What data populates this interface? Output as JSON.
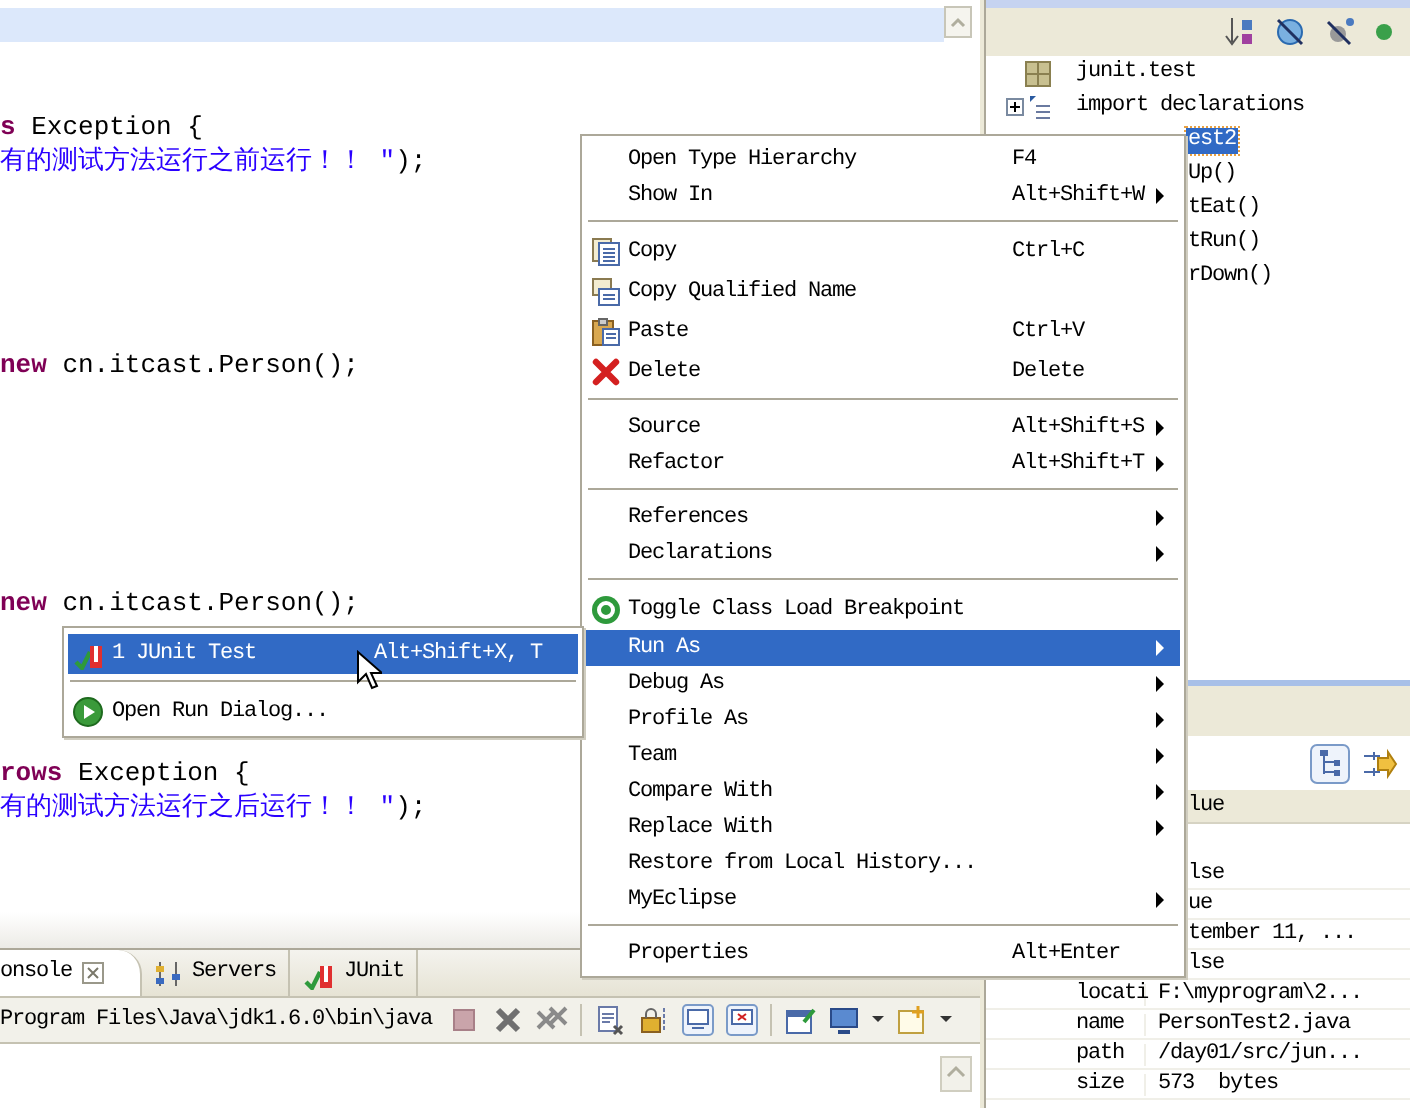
{
  "editor": {
    "lines": [
      {
        "kind": "blank",
        "current": true
      },
      {
        "kind": "blank",
        "current": false
      },
      {
        "kind": "blank",
        "current": false
      },
      {
        "kind": "code",
        "current": false,
        "segments": [
          {
            "kind": "keyword",
            "text": "s"
          },
          {
            "kind": "plain",
            "text": " Exception {"
          }
        ]
      },
      {
        "kind": "code",
        "current": false,
        "segments": [
          {
            "kind": "string",
            "text": "有的测试方法运行之前运行！！ \""
          },
          {
            "kind": "plain",
            "text": ");"
          }
        ]
      },
      {
        "kind": "blank",
        "current": false
      },
      {
        "kind": "blank",
        "current": false
      },
      {
        "kind": "blank",
        "current": false
      },
      {
        "kind": "blank",
        "current": false
      },
      {
        "kind": "blank",
        "current": false
      },
      {
        "kind": "code",
        "current": false,
        "segments": [
          {
            "kind": "keyword",
            "text": "new"
          },
          {
            "kind": "plain",
            "text": " cn.itcast.Person();"
          }
        ]
      },
      {
        "kind": "blank",
        "current": false
      },
      {
        "kind": "blank",
        "current": false
      },
      {
        "kind": "blank",
        "current": false
      },
      {
        "kind": "blank",
        "current": false
      },
      {
        "kind": "blank",
        "current": false
      },
      {
        "kind": "blank",
        "current": false
      },
      {
        "kind": "code",
        "current": false,
        "segments": [
          {
            "kind": "keyword",
            "text": "new"
          },
          {
            "kind": "plain",
            "text": " cn.itcast.Person();"
          }
        ]
      },
      {
        "kind": "blank",
        "current": false
      },
      {
        "kind": "blank",
        "current": false
      },
      {
        "kind": "blank",
        "current": false
      },
      {
        "kind": "blank",
        "current": false
      },
      {
        "kind": "code",
        "current": false,
        "segments": [
          {
            "kind": "keyword",
            "text": "rows"
          },
          {
            "kind": "plain",
            "text": " Exception {"
          }
        ]
      },
      {
        "kind": "code",
        "current": false,
        "segments": [
          {
            "kind": "string",
            "text": "有的测试方法运行之后运行！！ \""
          },
          {
            "kind": "plain",
            "text": ");"
          }
        ]
      }
    ]
  },
  "outline": {
    "tree": [
      {
        "kind": "package",
        "label": "junit.test",
        "selected": false
      },
      {
        "kind": "imports",
        "label": "import declarations",
        "expanded": false,
        "selected": false
      },
      {
        "kind": "class",
        "label": "est2",
        "selected": true,
        "children": [
          {
            "kind": "method",
            "label": "Up()",
            "selected": false
          },
          {
            "kind": "method",
            "label": "tEat()",
            "selected": false
          },
          {
            "kind": "method",
            "label": "tRun()",
            "selected": false
          },
          {
            "kind": "method",
            "label": "rDown()",
            "selected": false
          }
        ]
      }
    ]
  },
  "properties": {
    "column_header": "lue",
    "rows": [
      {
        "value": "lse"
      },
      {
        "value": "ue"
      },
      {
        "value": "tember 11, ..."
      },
      {
        "value": "lse"
      },
      {
        "property": "locati",
        "value": "F:\\myprogram\\2..."
      },
      {
        "property": "name",
        "value": "PersonTest2.java"
      },
      {
        "property": "path",
        "value": "/day01/src/jun..."
      },
      {
        "property": "size",
        "value": "573  bytes"
      }
    ]
  },
  "console": {
    "tabs": [
      {
        "kind": "console",
        "label": "onsole",
        "selected": true
      },
      {
        "kind": "servers",
        "label": "Servers",
        "selected": false
      },
      {
        "kind": "junit",
        "label": "JUnit",
        "selected": false
      }
    ],
    "process_label": "Program Files\\Java\\jdk1.6.0\\bin\\java"
  },
  "context_menu": {
    "items": [
      {
        "kind": "plain",
        "label": "Open Type Hierarchy",
        "shortcut": "F4",
        "submenu": false,
        "selected": false
      },
      {
        "kind": "plain",
        "label": "Show In",
        "shortcut": "Alt+Shift+W",
        "submenu": true,
        "selected": false
      },
      {
        "kind": "separator"
      },
      {
        "kind": "copy",
        "label": "Copy",
        "shortcut": "Ctrl+C",
        "submenu": false,
        "selected": false
      },
      {
        "kind": "copy-name",
        "label": "Copy Qualified Name",
        "submenu": false,
        "selected": false
      },
      {
        "kind": "paste",
        "label": "Paste",
        "shortcut": "Ctrl+V",
        "submenu": false,
        "selected": false
      },
      {
        "kind": "delete",
        "label": "Delete",
        "shortcut": "Delete",
        "submenu": false,
        "selected": false
      },
      {
        "kind": "separator"
      },
      {
        "kind": "plain",
        "label": "Source",
        "shortcut": "Alt+Shift+S",
        "submenu": true,
        "selected": false
      },
      {
        "kind": "plain",
        "label": "Refactor",
        "shortcut": "Alt+Shift+T",
        "submenu": true,
        "selected": false
      },
      {
        "kind": "separator"
      },
      {
        "kind": "plain",
        "label": "References",
        "submenu": true,
        "selected": false
      },
      {
        "kind": "plain",
        "label": "Declarations",
        "submenu": true,
        "selected": false
      },
      {
        "kind": "separator"
      },
      {
        "kind": "breakpoint",
        "label": "Toggle Class Load Breakpoint",
        "submenu": false,
        "selected": false
      },
      {
        "kind": "plain",
        "label": "Run As",
        "submenu": true,
        "selected": true
      },
      {
        "kind": "plain",
        "label": "Debug As",
        "submenu": true,
        "selected": false
      },
      {
        "kind": "plain",
        "label": "Profile As",
        "submenu": true,
        "selected": false
      },
      {
        "kind": "plain",
        "label": "Team",
        "submenu": true,
        "selected": false
      },
      {
        "kind": "plain",
        "label": "Compare With",
        "submenu": true,
        "selected": false
      },
      {
        "kind": "plain",
        "label": "Replace With",
        "submenu": true,
        "selected": false
      },
      {
        "kind": "plain",
        "label": "Restore from Local History...",
        "submenu": false,
        "selected": false
      },
      {
        "kind": "plain",
        "label": "MyEclipse",
        "submenu": true,
        "selected": false
      },
      {
        "kind": "separator"
      },
      {
        "kind": "plain",
        "label": "Properties",
        "shortcut": "Alt+Enter",
        "submenu": false,
        "selected": false
      }
    ]
  },
  "submenu": {
    "items": [
      {
        "kind": "junit",
        "label": "1 JUnit Test",
        "shortcut": "Alt+Shift+X, T",
        "submenu": false,
        "selected": true
      },
      {
        "kind": "separator"
      },
      {
        "kind": "run-dialog",
        "label": "Open Run Dialog...",
        "submenu": false,
        "selected": false
      }
    ]
  }
}
